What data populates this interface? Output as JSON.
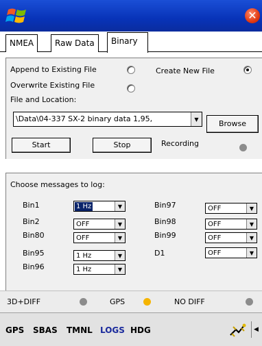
{
  "titlebar": {
    "close_glyph": "✕"
  },
  "tabs": [
    {
      "label": "NMEA"
    },
    {
      "label": "Raw Data"
    },
    {
      "label": "Binary"
    }
  ],
  "file": {
    "append_label": "Append to Existing File",
    "create_label": "Create New File",
    "overwrite_label": "Overwrite Existing File",
    "location_label": "File and Location:",
    "path_value": "\\Data\\04-337 SX-2 binary data 1,95,",
    "browse_label": "Browse",
    "start_label": "Start",
    "stop_label": "Stop",
    "recording_label": "Recording",
    "selected_mode": "create"
  },
  "messages": {
    "header": "Choose messages to log:",
    "left": [
      {
        "name": "Bin1",
        "value": "1 Hz"
      },
      {
        "name": "Bin2",
        "value": "OFF"
      },
      {
        "name": "Bin80",
        "value": "OFF"
      },
      {
        "name": "Bin95",
        "value": "1 Hz"
      },
      {
        "name": "Bin96",
        "value": "1 Hz"
      }
    ],
    "right": [
      {
        "name": "Bin97",
        "value": "OFF"
      },
      {
        "name": "Bin98",
        "value": "OFF"
      },
      {
        "name": "Bin99",
        "value": "OFF"
      },
      {
        "name": "D1",
        "value": "OFF"
      }
    ]
  },
  "status": {
    "diff_label": "3D+DIFF",
    "gps_label": "GPS",
    "nodiff_label": "NO DIFF",
    "colors": {
      "diff": "#8c8c8c",
      "gps": "#f5b400",
      "nodiff": "#8c8c8c",
      "recording": "#8c8c8c"
    }
  },
  "toolbar": {
    "items": [
      "GPS",
      "SBAS",
      "TMNL",
      "LOGS",
      "HDG"
    ],
    "active": "LOGS",
    "active_color": "#1a2a9c",
    "icon": "satellite-dish-icon"
  }
}
